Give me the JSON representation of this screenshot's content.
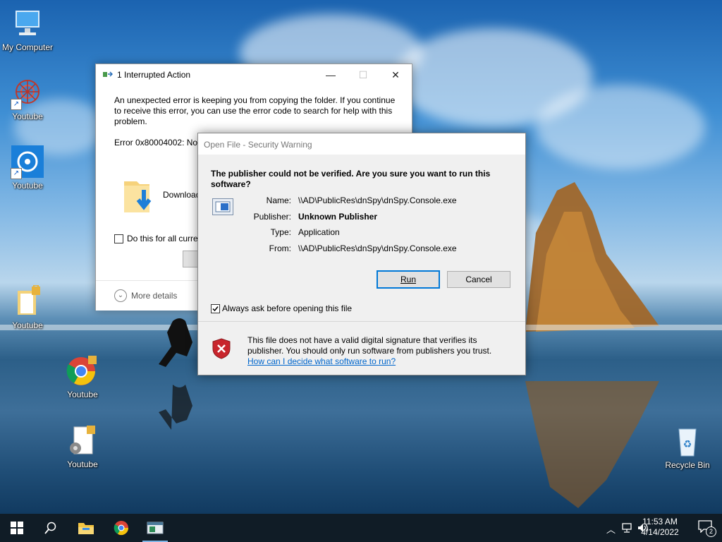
{
  "desktop": {
    "icons": [
      {
        "label": "My Computer",
        "icon": "computer-icon"
      },
      {
        "label": "Youtube",
        "icon": "red-mandala-icon"
      },
      {
        "label": "Youtube",
        "icon": "blue-disc-app-icon"
      },
      {
        "label": "Youtube",
        "icon": "locked-folder-icon"
      },
      {
        "label": "Youtube",
        "icon": "chrome-icon"
      },
      {
        "label": "Youtube",
        "icon": "locked-settings-file-icon"
      },
      {
        "label": "Recycle Bin",
        "icon": "recycle-bin-icon"
      }
    ]
  },
  "copy_dialog": {
    "title": "1 Interrupted Action",
    "message": "An unexpected error is keeping you from copying the folder. If you continue to receive this error, you can use the error code to search for help with this problem.",
    "error_text": "Error 0x80004002: No s",
    "download_label": "Download",
    "checkbox_label": "Do this for all curre",
    "more_details": "More details",
    "controls": {
      "minimize": "—",
      "maximize": "☐",
      "close": "✕"
    }
  },
  "security_dialog": {
    "title": "Open File - Security Warning",
    "question": "The publisher could not be verified.  Are you sure you want to run this software?",
    "fields": {
      "name_key": "Name:",
      "name_value": "\\\\AD\\PublicRes\\dnSpy\\dnSpy.Console.exe",
      "publisher_key": "Publisher:",
      "publisher_value": "Unknown Publisher",
      "type_key": "Type:",
      "type_value": "Application",
      "from_key": "From:",
      "from_value": "\\\\AD\\PublicRes\\dnSpy\\dnSpy.Console.exe"
    },
    "run_label": "Run",
    "cancel_label": "Cancel",
    "always_ask_label": "Always ask before opening this file",
    "always_ask_checked": true,
    "note": "This file does not have a valid digital signature that verifies its publisher.  You should only run software from publishers you trust.",
    "link": "How can I decide what software to run?"
  },
  "taskbar": {
    "items": [
      "start-icon",
      "search-icon",
      "file-explorer-icon",
      "chrome-icon",
      "app-window-icon"
    ],
    "time": "11:53 AM",
    "date": "4/14/2022",
    "notification_count": "2"
  },
  "colors": {
    "accent": "#0078d7",
    "taskbar": "#101c26",
    "link": "#0066cc"
  }
}
